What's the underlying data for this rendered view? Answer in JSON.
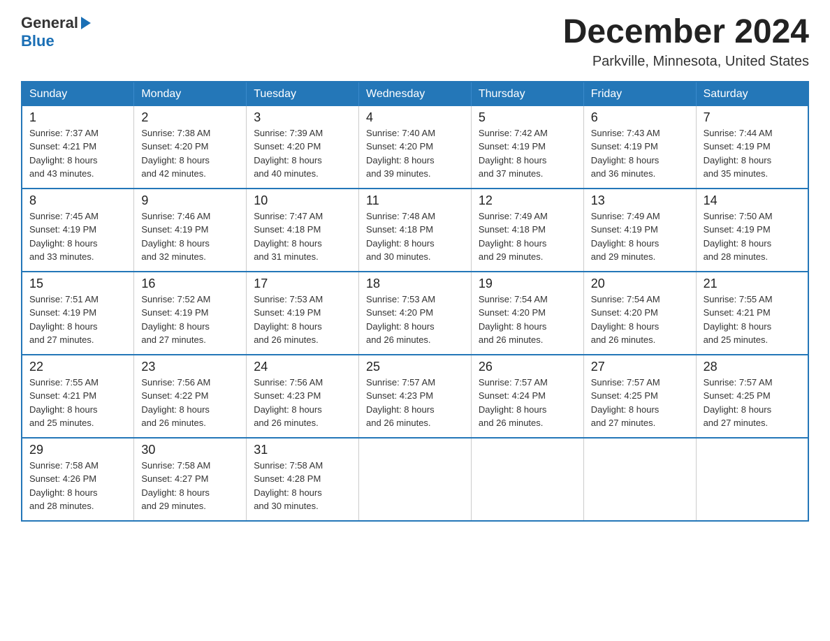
{
  "header": {
    "logo_text1": "General",
    "logo_text2": "Blue",
    "month_title": "December 2024",
    "subtitle": "Parkville, Minnesota, United States"
  },
  "days_of_week": [
    "Sunday",
    "Monday",
    "Tuesday",
    "Wednesday",
    "Thursday",
    "Friday",
    "Saturday"
  ],
  "weeks": [
    [
      {
        "day": "1",
        "sunrise": "7:37 AM",
        "sunset": "4:21 PM",
        "daylight": "8 hours and 43 minutes."
      },
      {
        "day": "2",
        "sunrise": "7:38 AM",
        "sunset": "4:20 PM",
        "daylight": "8 hours and 42 minutes."
      },
      {
        "day": "3",
        "sunrise": "7:39 AM",
        "sunset": "4:20 PM",
        "daylight": "8 hours and 40 minutes."
      },
      {
        "day": "4",
        "sunrise": "7:40 AM",
        "sunset": "4:20 PM",
        "daylight": "8 hours and 39 minutes."
      },
      {
        "day": "5",
        "sunrise": "7:42 AM",
        "sunset": "4:19 PM",
        "daylight": "8 hours and 37 minutes."
      },
      {
        "day": "6",
        "sunrise": "7:43 AM",
        "sunset": "4:19 PM",
        "daylight": "8 hours and 36 minutes."
      },
      {
        "day": "7",
        "sunrise": "7:44 AM",
        "sunset": "4:19 PM",
        "daylight": "8 hours and 35 minutes."
      }
    ],
    [
      {
        "day": "8",
        "sunrise": "7:45 AM",
        "sunset": "4:19 PM",
        "daylight": "8 hours and 33 minutes."
      },
      {
        "day": "9",
        "sunrise": "7:46 AM",
        "sunset": "4:19 PM",
        "daylight": "8 hours and 32 minutes."
      },
      {
        "day": "10",
        "sunrise": "7:47 AM",
        "sunset": "4:18 PM",
        "daylight": "8 hours and 31 minutes."
      },
      {
        "day": "11",
        "sunrise": "7:48 AM",
        "sunset": "4:18 PM",
        "daylight": "8 hours and 30 minutes."
      },
      {
        "day": "12",
        "sunrise": "7:49 AM",
        "sunset": "4:18 PM",
        "daylight": "8 hours and 29 minutes."
      },
      {
        "day": "13",
        "sunrise": "7:49 AM",
        "sunset": "4:19 PM",
        "daylight": "8 hours and 29 minutes."
      },
      {
        "day": "14",
        "sunrise": "7:50 AM",
        "sunset": "4:19 PM",
        "daylight": "8 hours and 28 minutes."
      }
    ],
    [
      {
        "day": "15",
        "sunrise": "7:51 AM",
        "sunset": "4:19 PM",
        "daylight": "8 hours and 27 minutes."
      },
      {
        "day": "16",
        "sunrise": "7:52 AM",
        "sunset": "4:19 PM",
        "daylight": "8 hours and 27 minutes."
      },
      {
        "day": "17",
        "sunrise": "7:53 AM",
        "sunset": "4:19 PM",
        "daylight": "8 hours and 26 minutes."
      },
      {
        "day": "18",
        "sunrise": "7:53 AM",
        "sunset": "4:20 PM",
        "daylight": "8 hours and 26 minutes."
      },
      {
        "day": "19",
        "sunrise": "7:54 AM",
        "sunset": "4:20 PM",
        "daylight": "8 hours and 26 minutes."
      },
      {
        "day": "20",
        "sunrise": "7:54 AM",
        "sunset": "4:20 PM",
        "daylight": "8 hours and 26 minutes."
      },
      {
        "day": "21",
        "sunrise": "7:55 AM",
        "sunset": "4:21 PM",
        "daylight": "8 hours and 25 minutes."
      }
    ],
    [
      {
        "day": "22",
        "sunrise": "7:55 AM",
        "sunset": "4:21 PM",
        "daylight": "8 hours and 25 minutes."
      },
      {
        "day": "23",
        "sunrise": "7:56 AM",
        "sunset": "4:22 PM",
        "daylight": "8 hours and 26 minutes."
      },
      {
        "day": "24",
        "sunrise": "7:56 AM",
        "sunset": "4:23 PM",
        "daylight": "8 hours and 26 minutes."
      },
      {
        "day": "25",
        "sunrise": "7:57 AM",
        "sunset": "4:23 PM",
        "daylight": "8 hours and 26 minutes."
      },
      {
        "day": "26",
        "sunrise": "7:57 AM",
        "sunset": "4:24 PM",
        "daylight": "8 hours and 26 minutes."
      },
      {
        "day": "27",
        "sunrise": "7:57 AM",
        "sunset": "4:25 PM",
        "daylight": "8 hours and 27 minutes."
      },
      {
        "day": "28",
        "sunrise": "7:57 AM",
        "sunset": "4:25 PM",
        "daylight": "8 hours and 27 minutes."
      }
    ],
    [
      {
        "day": "29",
        "sunrise": "7:58 AM",
        "sunset": "4:26 PM",
        "daylight": "8 hours and 28 minutes."
      },
      {
        "day": "30",
        "sunrise": "7:58 AM",
        "sunset": "4:27 PM",
        "daylight": "8 hours and 29 minutes."
      },
      {
        "day": "31",
        "sunrise": "7:58 AM",
        "sunset": "4:28 PM",
        "daylight": "8 hours and 30 minutes."
      },
      null,
      null,
      null,
      null
    ]
  ],
  "labels": {
    "sunrise": "Sunrise:",
    "sunset": "Sunset:",
    "daylight": "Daylight:"
  }
}
